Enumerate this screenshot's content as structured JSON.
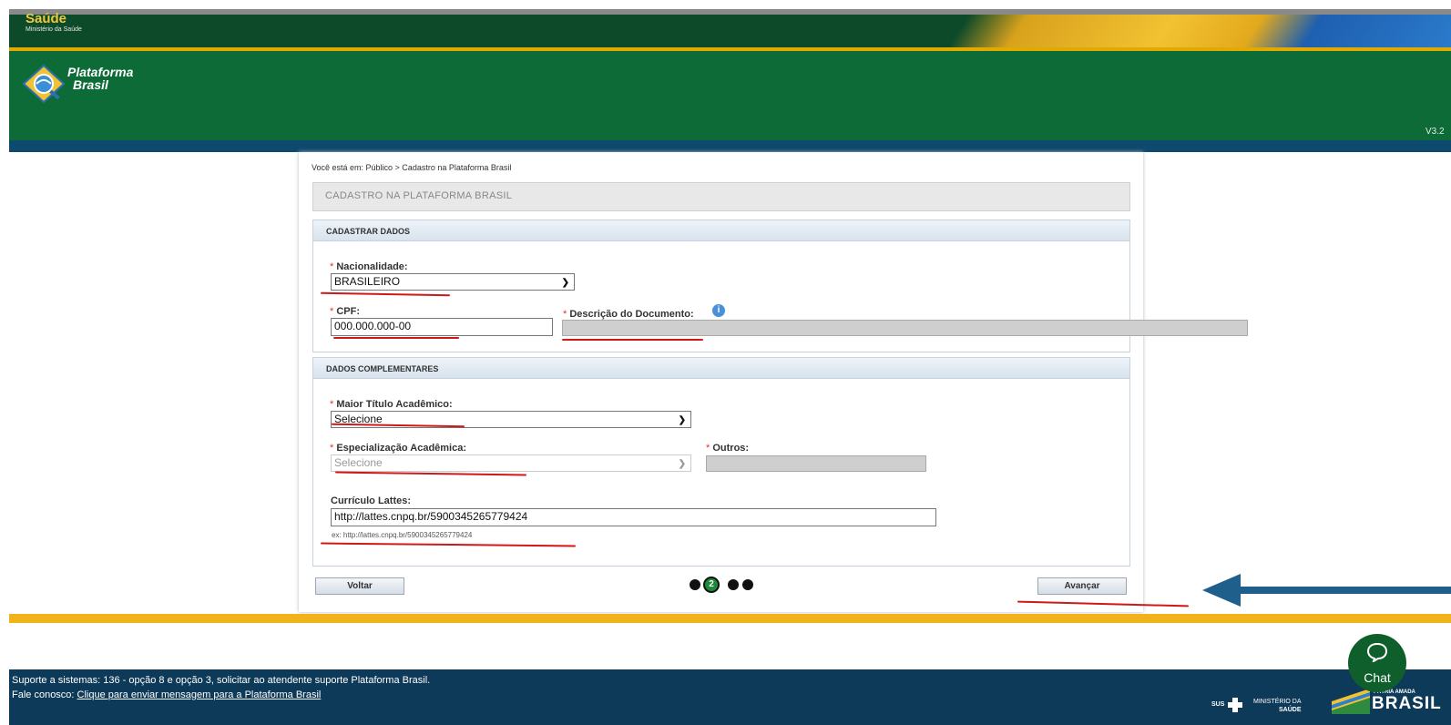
{
  "gov": {
    "saude": "Saúde",
    "ministerio": "Ministério da Saúde"
  },
  "brand": {
    "line1": "Plataforma",
    "line2": "Brasil",
    "version": "V3.2"
  },
  "breadcrumb": "Você está em: Público > Cadastro na Plataforma Brasil",
  "page_title": "CADASTRO NA PLATAFORMA BRASIL",
  "section1": {
    "title": "CADASTRAR DADOS",
    "nacionalidade_label": "Nacionalidade:",
    "nacionalidade_value": "BRASILEIRO",
    "cpf_label": "CPF:",
    "cpf_value": "000.000.000-00",
    "descricao_label": "Descrição do Documento:"
  },
  "section2": {
    "title": "DADOS COMPLEMENTARES",
    "titulo_label": "Maior Título Acadêmico:",
    "titulo_value": "Selecione",
    "especializacao_label": "Especialização Acadêmica:",
    "especializacao_value": "Selecione",
    "outros_label": "Outros:",
    "lattes_label": "Currículo Lattes:",
    "lattes_value": "http://lattes.cnpq.br/5900345265779424",
    "lattes_hint": "ex: http://lattes.cnpq.br/5900345265779424"
  },
  "nav": {
    "back": "Voltar",
    "next": "Avançar",
    "step": "2"
  },
  "footer": {
    "support": "Suporte a sistemas: 136 - opção 8 e opção 3, solicitar ao atendente suporte Plataforma Brasil.",
    "contact_prefix": "Fale conosco:",
    "contact_link": "Clique para enviar mensagem para a Plataforma Brasil",
    "sus": "SUS",
    "ministerio": "MINISTÉRIO DA",
    "saude": "SAÚDE",
    "brasil_top": "PÁTRIA AMADA",
    "brasil": "BRASIL"
  },
  "chat": {
    "label": "Chat"
  },
  "colors": {
    "header_green": "#0d6b37",
    "annotation_red": "#d01818",
    "annotation_arrow": "#1f5f8b",
    "footer_blue": "#0e3a59",
    "accent_gold": "#f0b31a"
  }
}
